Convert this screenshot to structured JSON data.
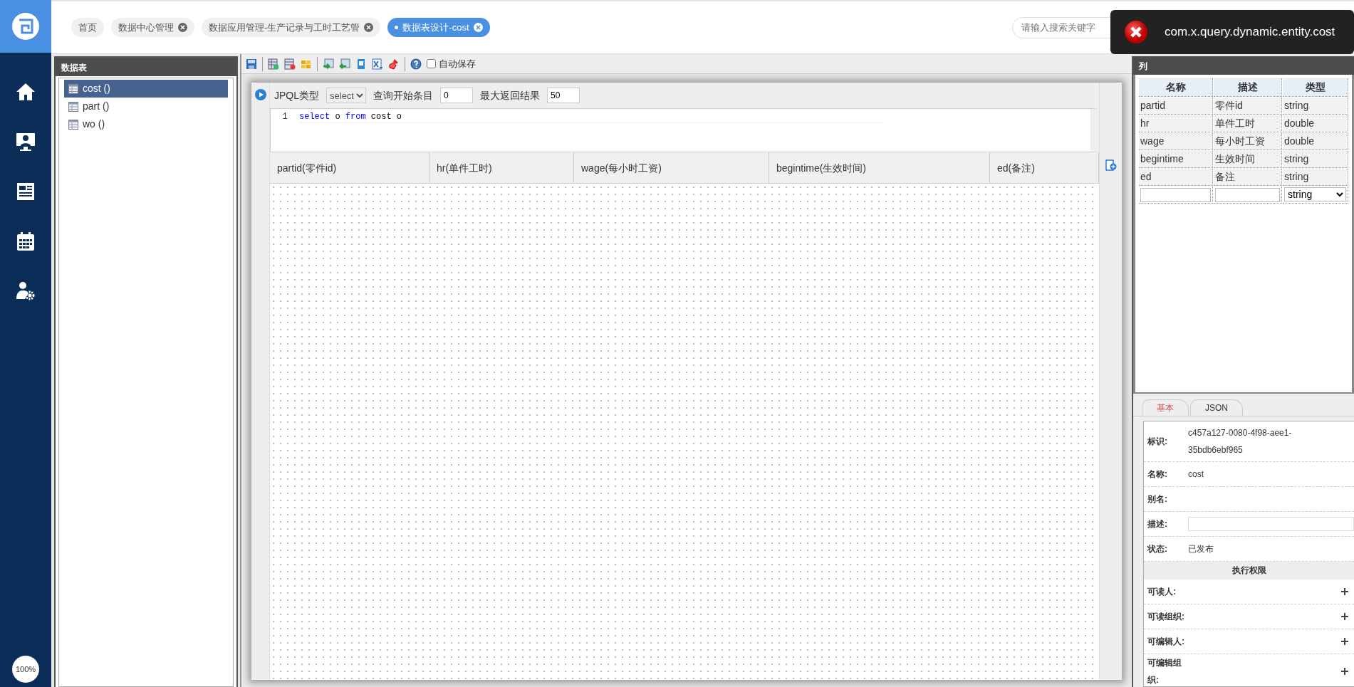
{
  "sidebar": {
    "zoom": "100%"
  },
  "tabs": [
    {
      "label": "首页",
      "closable": false,
      "selected": false
    },
    {
      "label": "数据中心管理",
      "closable": true,
      "selected": false
    },
    {
      "label": "数据应用管理-生产记录与工时工艺管",
      "closable": true,
      "selected": false
    },
    {
      "label": "数据表设计-cost",
      "closable": true,
      "selected": true
    }
  ],
  "search": {
    "placeholder": "请输入搜索关键字"
  },
  "toast": {
    "kind": "error",
    "message": "com.x.query.dynamic.entity.cost"
  },
  "tables_panel": {
    "title": "数据表",
    "items": [
      {
        "label": "cost ()",
        "selected": true
      },
      {
        "label": "part ()",
        "selected": false
      },
      {
        "label": "wo ()",
        "selected": false
      }
    ]
  },
  "toolbar": {
    "autosave": {
      "label": "自动保存",
      "checked": false
    }
  },
  "query": {
    "type_label": "JPQL类型",
    "type_value": "select",
    "start_label": "查询开始条目",
    "start_value": "0",
    "max_label": "最大返回结果",
    "max_value": "50",
    "code": [
      {
        "number": "1",
        "tokens": [
          {
            "text": "select",
            "kind": "keyword"
          },
          {
            "text": " o ",
            "kind": "plain"
          },
          {
            "text": "from",
            "kind": "keyword"
          },
          {
            "text": " cost o",
            "kind": "plain"
          }
        ]
      }
    ]
  },
  "result_columns": [
    "partid(零件id)",
    "hr(单件工时)",
    "wage(每小时工资)",
    "begintime(生效时间)",
    "ed(备注)"
  ],
  "columns_panel": {
    "title": "列",
    "headers": [
      "名称",
      "描述",
      "类型"
    ],
    "rows": [
      [
        "partid",
        "零件id",
        "string"
      ],
      [
        "hr",
        "单件工时",
        "double"
      ],
      [
        "wage",
        "每小时工资",
        "double"
      ],
      [
        "begintime",
        "生效时间",
        "string"
      ],
      [
        "ed",
        "备注",
        "string"
      ]
    ],
    "new_row": {
      "type": "string"
    }
  },
  "properties": {
    "tabs": [
      {
        "label": "基本",
        "selected": true
      },
      {
        "label": "JSON",
        "selected": false
      }
    ],
    "fields": [
      {
        "label": "标识:",
        "kind": "text",
        "value": "c457a127-0080-4f98-aee1-35bdb6ebf965"
      },
      {
        "label": "名称:",
        "kind": "text",
        "value": "cost"
      },
      {
        "label": "别名:",
        "kind": "text"
      },
      {
        "label": "描述:",
        "kind": "input"
      },
      {
        "label": "状态:",
        "kind": "text",
        "value": "已发布"
      }
    ],
    "permissions": {
      "title": "执行权限",
      "items": [
        "可读人:",
        "可读组织:",
        "可编辑人:",
        "可编辑组织:"
      ]
    }
  }
}
